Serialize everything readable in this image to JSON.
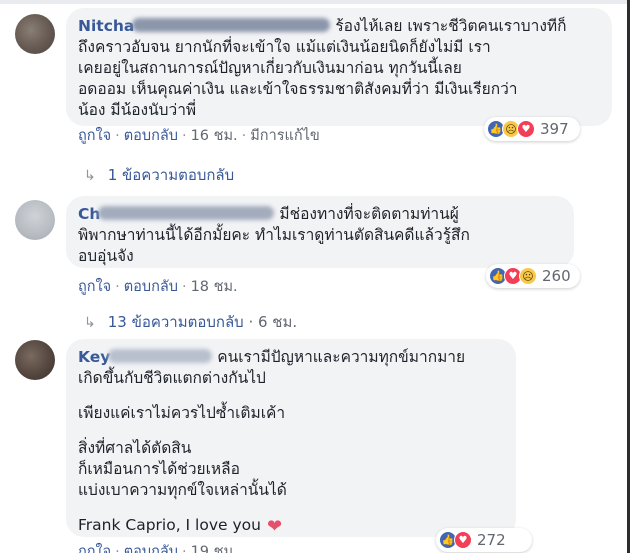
{
  "comments": [
    {
      "author_visible": "Nitcha",
      "text_lines": [
        "ร้องไห้เลย เพราะชีวิตคนเราบางทีก็",
        "ถึงคราวอับจน ยากนักที่จะเข้าใจ แม้แต่เงินน้อยนิดก็ยังไม่มี เรา",
        "เคยอยู่ในสถานการณ์ปัญหาเกี่ยวกับเงินมาก่อน ทุกวันนี้เลย",
        "อดออม เห็นคุณค่าเงิน และเข้าใจธรรมชาติสังคมที่ว่า มีเงินเรียกว่า",
        "น้อง มีน้องนับว่าพี่"
      ],
      "like_label": "ถูกใจ",
      "reply_label": "ตอบกลับ",
      "time": "16 ชม.",
      "edited_label": "มีการแก้ไข",
      "reaction_count": "397",
      "replies_label": "1 ข้อความตอบกลับ"
    },
    {
      "author_visible": "Ch",
      "text_lines": [
        "มีช่องทางที่จะติดตามท่านผู้",
        "พิพากษาท่านนี้ได้อีกมั้ยคะ ทำไมเราดูท่านตัดสินคดีแล้วรู้สึก",
        "อบอุ่นจัง"
      ],
      "like_label": "ถูกใจ",
      "reply_label": "ตอบกลับ",
      "time": "18 ชม.",
      "reaction_count": "260",
      "replies_label": "13 ข้อความตอบกลับ",
      "replies_time": "6 ชม."
    },
    {
      "author_visible": "Key",
      "paragraphs": [
        [
          "คนเรามีปัญหาและความทุกข์มากมาย",
          "เกิดขึ้นกับชีวิตแตกต่างกันไป"
        ],
        [
          "เพียงแค่เราไม่ควรไปซ้ำเติมเค้า"
        ],
        [
          "สิ่งที่ศาลได้ตัดสิน",
          "ก็เหมือนการได้ช่วยเหลือ",
          "แบ่งเบาความทุกข์ใจเหล่านั้นได้"
        ],
        [
          "Frank Caprio, I love you"
        ]
      ],
      "like_label": "ถูกใจ",
      "reply_label": "ตอบกลับ",
      "time": "19 ชม.",
      "reaction_count": "272"
    }
  ],
  "icons": {
    "reply_arrow": "reply-arrow-icon",
    "like": "like-reaction-icon",
    "love": "love-reaction-icon",
    "sad": "sad-reaction-icon",
    "heart_emoji": "heart-emoji-icon"
  },
  "colors": {
    "link": "#385898",
    "bubble": "#f2f3f5",
    "meta": "#616770",
    "like": "#4267b2",
    "love": "#f33e58",
    "sad": "#f7c94a"
  }
}
